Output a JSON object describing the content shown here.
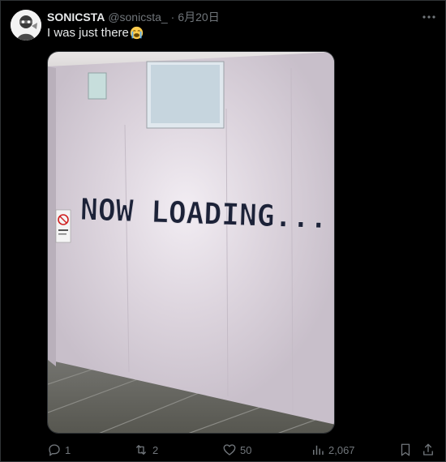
{
  "tweet": {
    "author": {
      "display_name": "SONICSTA",
      "handle": "@sonicsta_",
      "separator": "·",
      "date": "6月20日",
      "avatar_icon": "avatar-image"
    },
    "text": "I was just there",
    "emoji": "loudly-crying-face",
    "media": {
      "sign_text": "NOW LOADING...",
      "description_icon": "photo"
    },
    "actions": {
      "replies": "1",
      "retweets": "2",
      "likes": "50",
      "views": "2,067"
    }
  },
  "colors": {
    "background": "#000000",
    "text_primary": "#e7e9ea",
    "text_secondary": "#71767b",
    "border": "#2f3336",
    "wall": "#ddd6de",
    "sign_fill": "#1c2238"
  }
}
